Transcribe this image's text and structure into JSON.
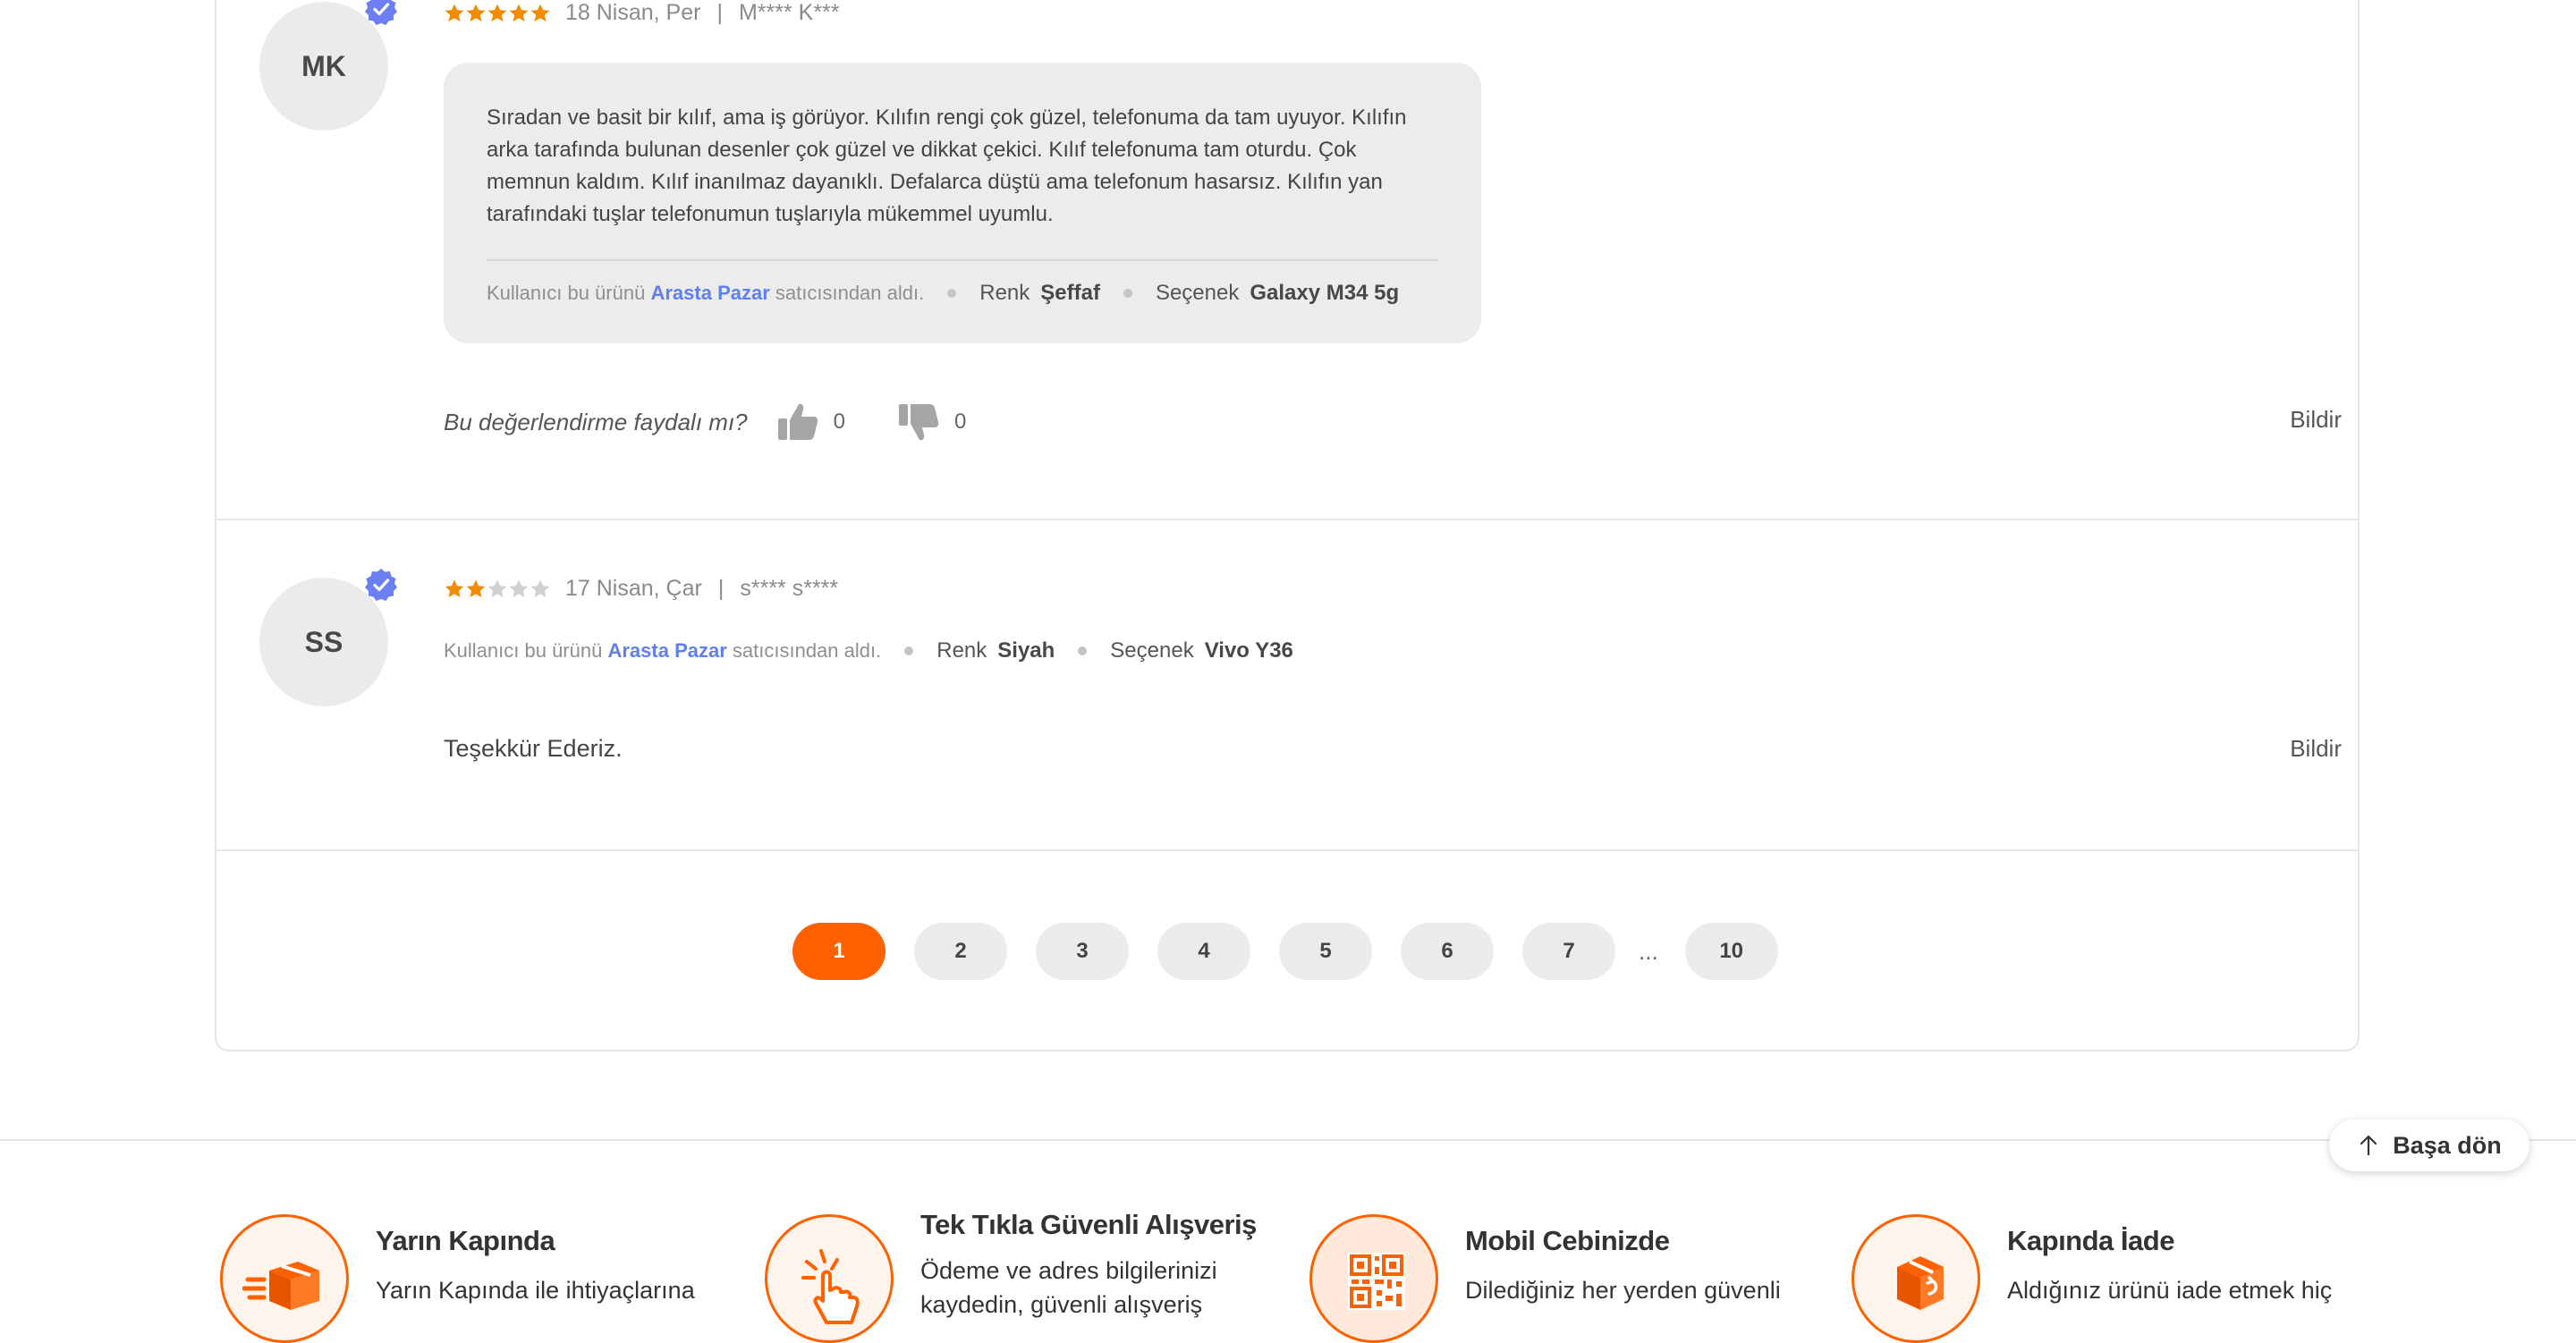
{
  "reviews": [
    {
      "initials": "MK",
      "rating": 5,
      "date": "18 Nisan, Per",
      "author": "M**** K***",
      "text": "Sıradan ve basit bir kılıf, ama iş görüyor. Kılıfın rengi çok güzel, telefonuma da tam uyuyor. Kılıfın arka tarafında bulunan desenler çok güzel ve dikkat çekici. Kılıf telefonuma tam oturdu. Çok memnun kaldım. Kılıf inanılmaz dayanıklı. Defalarca düştü ama telefonum hasarsız. Kılıfın yan tarafındaki tuşlar telefonumun tuşlarıyla mükemmel uyumlu.",
      "bought_prefix": "Kullanıcı bu ürünü",
      "seller": "Arasta Pazar",
      "bought_suffix": "satıcısından aldı.",
      "color_label": "Renk",
      "color_value": "Şeffaf",
      "option_label": "Seçenek",
      "option_value": "Galaxy M34 5g",
      "helpful_question": "Bu değerlendirme faydalı mı?",
      "likes": "0",
      "dislikes": "0",
      "report": "Bildir"
    },
    {
      "initials": "SS",
      "rating": 2,
      "date": "17 Nisan, Çar",
      "author": "s**** s****",
      "bought_prefix": "Kullanıcı bu ürünü",
      "seller": "Arasta Pazar",
      "bought_suffix": "satıcısından aldı.",
      "color_label": "Renk",
      "color_value": "Siyah",
      "option_label": "Seçenek",
      "option_value": "Vivo Y36",
      "text": "Teşekkür Ederiz.",
      "report": "Bildir"
    }
  ],
  "pagination": {
    "pages": [
      "1",
      "2",
      "3",
      "4",
      "5",
      "6",
      "7"
    ],
    "ellipsis": "...",
    "last": "10",
    "active": "1"
  },
  "back_to_top": "Başa dön",
  "features": [
    {
      "title": "Yarın Kapında",
      "desc": "Yarın Kapında ile ihtiyaçlarına",
      "icon": "delivery-box-icon"
    },
    {
      "title": "Tek Tıkla Güvenli Alışveriş",
      "desc": "Ödeme ve adres bilgilerinizi kaydedin, güvenli alışveriş",
      "icon": "one-click-icon"
    },
    {
      "title": "Mobil Cebinizde",
      "desc": "Dilediğiniz her yerden güvenli",
      "icon": "qr-code-icon"
    },
    {
      "title": "Kapında İade",
      "desc": "Aldığınız ürünü iade etmek hiç",
      "icon": "return-box-icon"
    }
  ],
  "colors": {
    "accent": "#ff6000",
    "star": "#f28b00",
    "seller_link": "#5d7ff0",
    "verified": "#6b7ff2"
  }
}
